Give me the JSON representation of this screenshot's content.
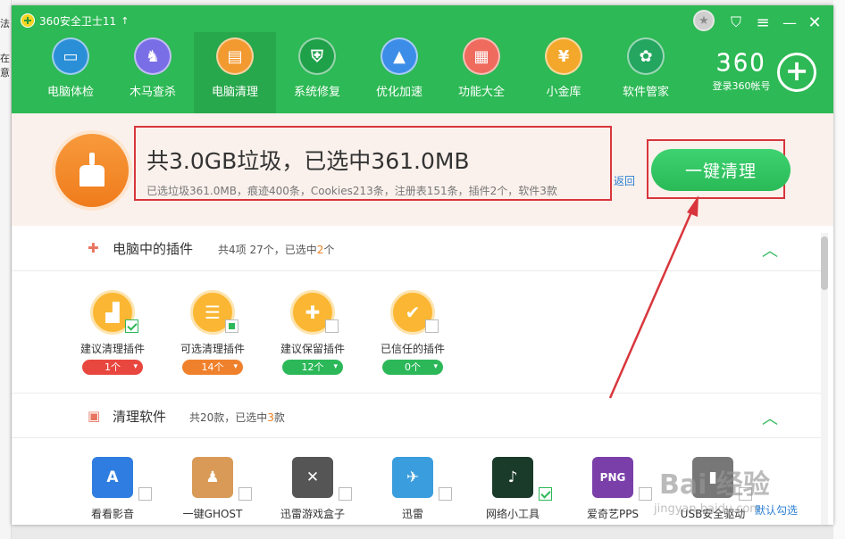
{
  "background": {
    "left_text_1": "法",
    "left_text_2": "在意"
  },
  "app": {
    "title": "360安全卫士11",
    "update_arrow": "↑"
  },
  "window_controls": {
    "medal": "★",
    "skin": "⛉",
    "menu": "≡",
    "minimize": "—",
    "close": "✕"
  },
  "nav": [
    {
      "label": "电脑体检",
      "color": "#2b8fd8",
      "glyph": "▭"
    },
    {
      "label": "木马查杀",
      "color": "#7a6ee6",
      "glyph": "♞"
    },
    {
      "label": "电脑清理",
      "color": "#f29a30",
      "glyph": "▤"
    },
    {
      "label": "系统修复",
      "color": "#1fa14a",
      "glyph": "⛨"
    },
    {
      "label": "优化加速",
      "color": "#3c8de8",
      "glyph": "▲"
    },
    {
      "label": "功能大全",
      "color": "#ef6b5d",
      "glyph": "▦"
    },
    {
      "label": "小金库",
      "color": "#f3a82b",
      "glyph": "¥"
    },
    {
      "label": "软件管家",
      "color": "#24a660",
      "glyph": "✿"
    }
  ],
  "brand": {
    "logo": "360",
    "login": "登录360帐号",
    "plus": "+"
  },
  "summary": {
    "title": "共3.0GB垃圾，已选中361.0MB",
    "detail": "已选垃圾361.0MB，痕迹400条，Cookies213条，注册表151条，插件2个，软件3款",
    "back": "返回",
    "clean_button": "一键清理"
  },
  "sections": {
    "plugins": {
      "icon": "✚",
      "title": "电脑中的插件",
      "info_prefix": "共4项 27个，已选中",
      "info_num": "2",
      "info_suffix": "个",
      "collapse": "︿"
    },
    "software": {
      "icon": "▣",
      "title": "清理软件",
      "info_prefix": "共20款，已选中",
      "info_num": "3",
      "info_suffix": "款",
      "collapse": "︿"
    }
  },
  "plugins": [
    {
      "label": "建议清理插件",
      "count": "1个",
      "pill_color": "#e8473f",
      "glyph": "▟"
    },
    {
      "label": "可选清理插件",
      "count": "14个",
      "pill_color": "#f0812c",
      "glyph": "☰"
    },
    {
      "label": "建议保留插件",
      "count": "12个",
      "pill_color": "#2cb859",
      "glyph": "✚"
    },
    {
      "label": "已信任的插件",
      "count": "0个",
      "pill_color": "#2cb859",
      "glyph": "✔"
    }
  ],
  "software": [
    {
      "label": "看看影音",
      "color": "#2f7de0",
      "glyph": "A"
    },
    {
      "label": "一键GHOST",
      "color": "#d89a56",
      "glyph": "♟"
    },
    {
      "label": "迅雷游戏盒子",
      "color": "#555555",
      "glyph": "✕"
    },
    {
      "label": "迅雷",
      "color": "#3a9ddd",
      "glyph": "✈"
    },
    {
      "label": "网络小工具",
      "color": "#1a3a2a",
      "glyph": "♪"
    },
    {
      "label": "爱奇艺PPS",
      "color": "#7a3fa8",
      "glyph": "PNG"
    },
    {
      "label": "USB安全驱动",
      "color": "#777777",
      "glyph": "▮"
    }
  ],
  "footer": {
    "link": "默认勾选"
  },
  "watermark": {
    "main": "Bai  经验",
    "sub": "jingyan.baidu.com"
  },
  "colors": {
    "header_green": "#2db955",
    "accent_green": "#2cb859",
    "annotation_red": "#d8363c",
    "accent_orange": "#f07c1c"
  }
}
